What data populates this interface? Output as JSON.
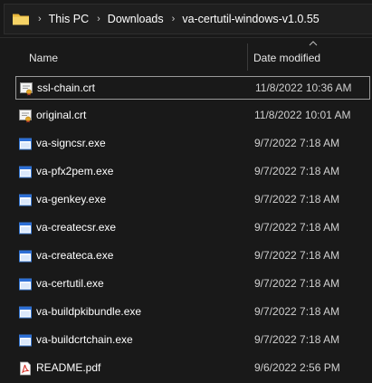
{
  "breadcrumb": {
    "items": [
      "This PC",
      "Downloads",
      "va-certutil-windows-v1.0.55"
    ],
    "separator": "›"
  },
  "columns": {
    "name": "Name",
    "date_modified": "Date modified"
  },
  "files": [
    {
      "name": "ssl-chain.crt",
      "date": "11/8/2022 10:36 AM",
      "icon": "certificate-icon",
      "selected": true
    },
    {
      "name": "original.crt",
      "date": "11/8/2022 10:01 AM",
      "icon": "certificate-icon"
    },
    {
      "name": "va-signcsr.exe",
      "date": "9/7/2022 7:18 AM",
      "icon": "executable-icon"
    },
    {
      "name": "va-pfx2pem.exe",
      "date": "9/7/2022 7:18 AM",
      "icon": "executable-icon"
    },
    {
      "name": "va-genkey.exe",
      "date": "9/7/2022 7:18 AM",
      "icon": "executable-icon"
    },
    {
      "name": "va-createcsr.exe",
      "date": "9/7/2022 7:18 AM",
      "icon": "executable-icon"
    },
    {
      "name": "va-createca.exe",
      "date": "9/7/2022 7:18 AM",
      "icon": "executable-icon"
    },
    {
      "name": "va-certutil.exe",
      "date": "9/7/2022 7:18 AM",
      "icon": "executable-icon"
    },
    {
      "name": "va-buildpkibundle.exe",
      "date": "9/7/2022 7:18 AM",
      "icon": "executable-icon"
    },
    {
      "name": "va-buildcrtchain.exe",
      "date": "9/7/2022 7:18 AM",
      "icon": "executable-icon"
    },
    {
      "name": "README.pdf",
      "date": "9/6/2022 2:56 PM",
      "icon": "pdf-icon"
    }
  ],
  "colors": {
    "background": "#191919",
    "selection_border": "#9a9a9a",
    "folder": "#f2c94c",
    "exe_blue": "#2d6fd6"
  }
}
